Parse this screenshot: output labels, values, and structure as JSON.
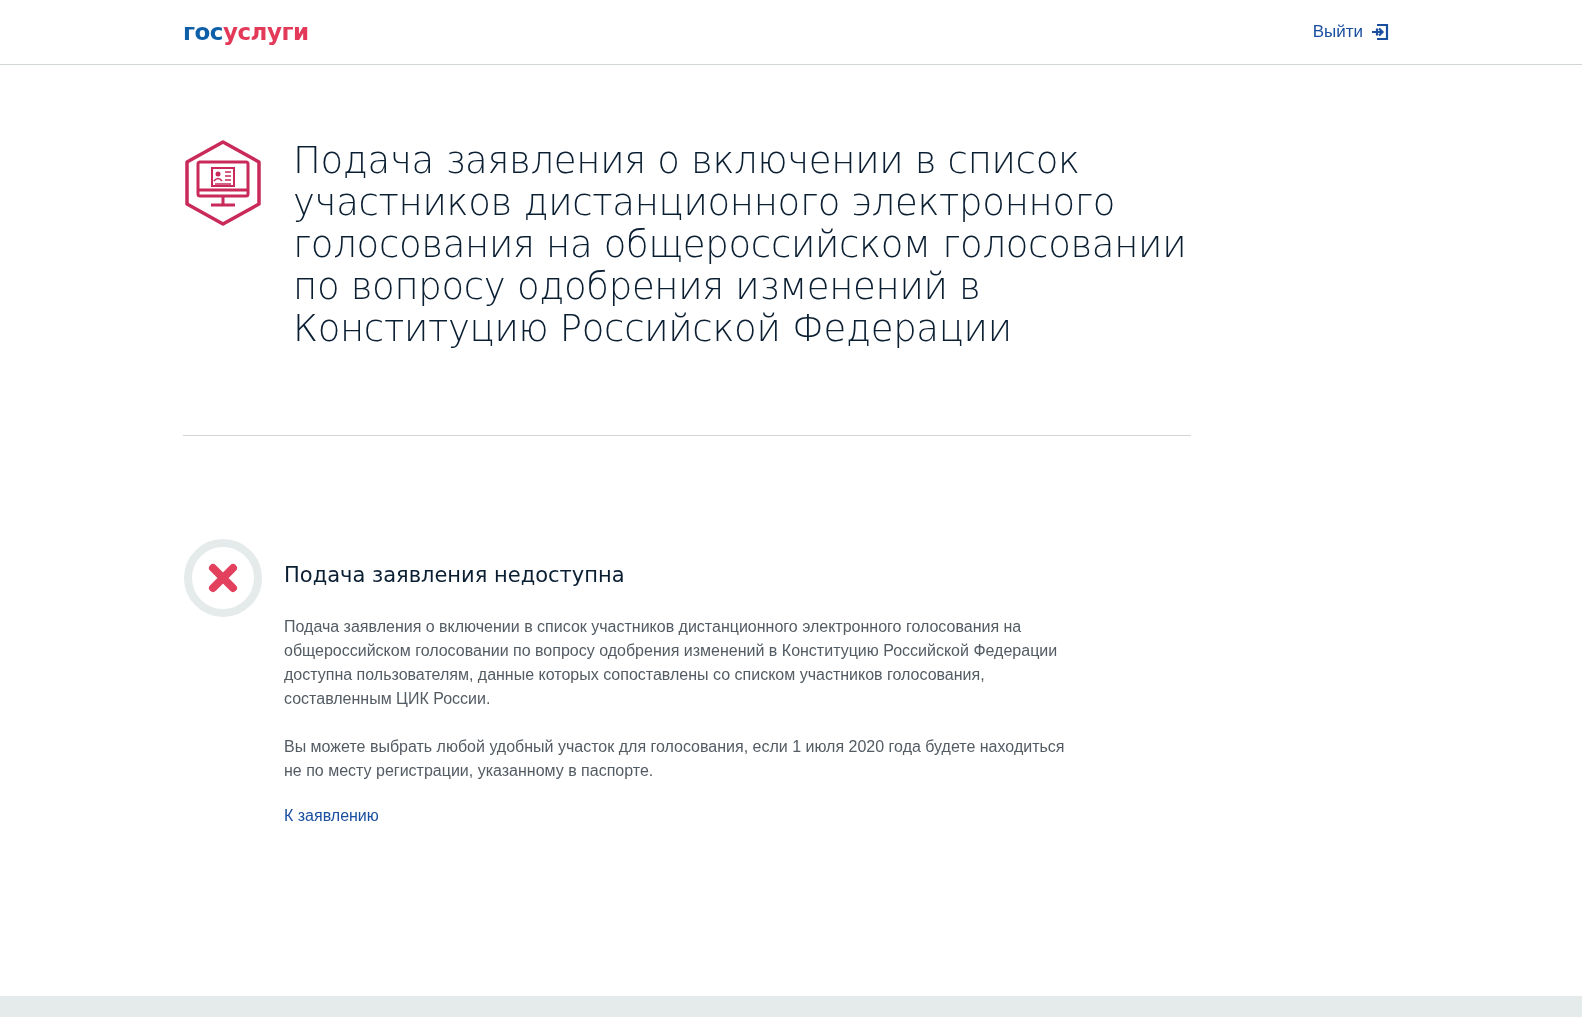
{
  "header": {
    "logo": {
      "part_1": "гос",
      "part_2": "услуги"
    },
    "logout": "Выйти"
  },
  "page_title": "Подача заявления о включении в список участников дистанционного электронного голосования на общероссийском голосовании по вопросу одобрения изменений в Конституцию Российской Федерации",
  "notice": {
    "kind": "error",
    "title": "Подача заявления недоступна",
    "paragraphs": [
      "Подача заявления о включении в список участников дистанционного электронного голосования на общероссийском голосовании по вопросу одобрения изменений в Конституцию Российской Федерации доступна пользователям, данные которых сопоставлены со списком участников голосования, составленным ЦИК России.",
      "Вы можете выбрать любой удобный участок для голосования, если 1 июля 2020 года будете находиться не по месту регистрации, указанному в паспорте."
    ],
    "link": "К заявлению"
  }
}
